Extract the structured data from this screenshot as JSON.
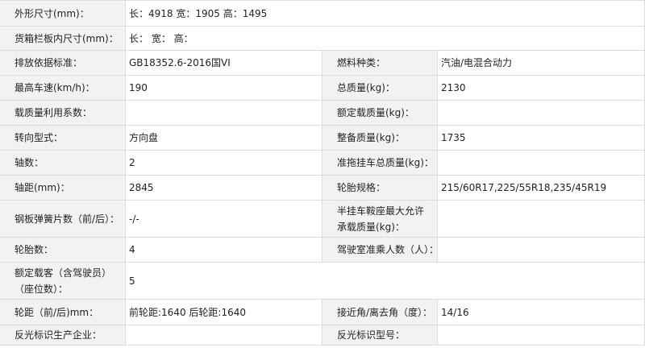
{
  "rows": [
    {
      "l1": "外形尺寸(mm)：",
      "v1": "长：4918 宽：1905 高：1495"
    },
    {
      "l1": "货箱栏板内尺寸(mm)：",
      "v1": "长： 宽： 高："
    },
    {
      "l1": "排放依据标准：",
      "v1": "GB18352.6-2016国VI",
      "l2": "燃料种类：",
      "v2": "汽油/电混合动力"
    },
    {
      "l1": "最高车速(km/h)：",
      "v1": "190",
      "l2": "总质量(kg)：",
      "v2": "2130"
    },
    {
      "l1": "载质量利用系数：",
      "v1": "",
      "l2": "额定载质量(kg)：",
      "v2": ""
    },
    {
      "l1": "转向型式：",
      "v1": "方向盘",
      "l2": "整备质量(kg)：",
      "v2": "1735"
    },
    {
      "l1": "轴数：",
      "v1": "2",
      "l2": "准拖挂车总质量(kg)：",
      "v2": ""
    },
    {
      "l1": "轴距(mm)：",
      "v1": "2845",
      "l2": "轮胎规格：",
      "v2": "215/60R17,225/55R18,235/45R19"
    },
    {
      "l1": "钢板弹簧片数（前/后）：",
      "v1": "-/-",
      "l2": "半挂车鞍座最大允许承载质量(kg)：",
      "v2": ""
    },
    {
      "l1": "轮胎数：",
      "v1": "4",
      "l2": "驾驶室准乘人数（人）：",
      "v2": ""
    },
    {
      "l1": "额定载客（含驾驶员）（座位数）：",
      "v1": "5"
    },
    {
      "l1": "轮距（前/后)mm：",
      "v1": "前轮距:1640 后轮距:1640",
      "l2": "接近角/离去角（度）：",
      "v2": "14/16"
    },
    {
      "l1": "反光标识生产企业：",
      "v1": "",
      "l2": "反光标识型号：",
      "v2": ""
    }
  ]
}
